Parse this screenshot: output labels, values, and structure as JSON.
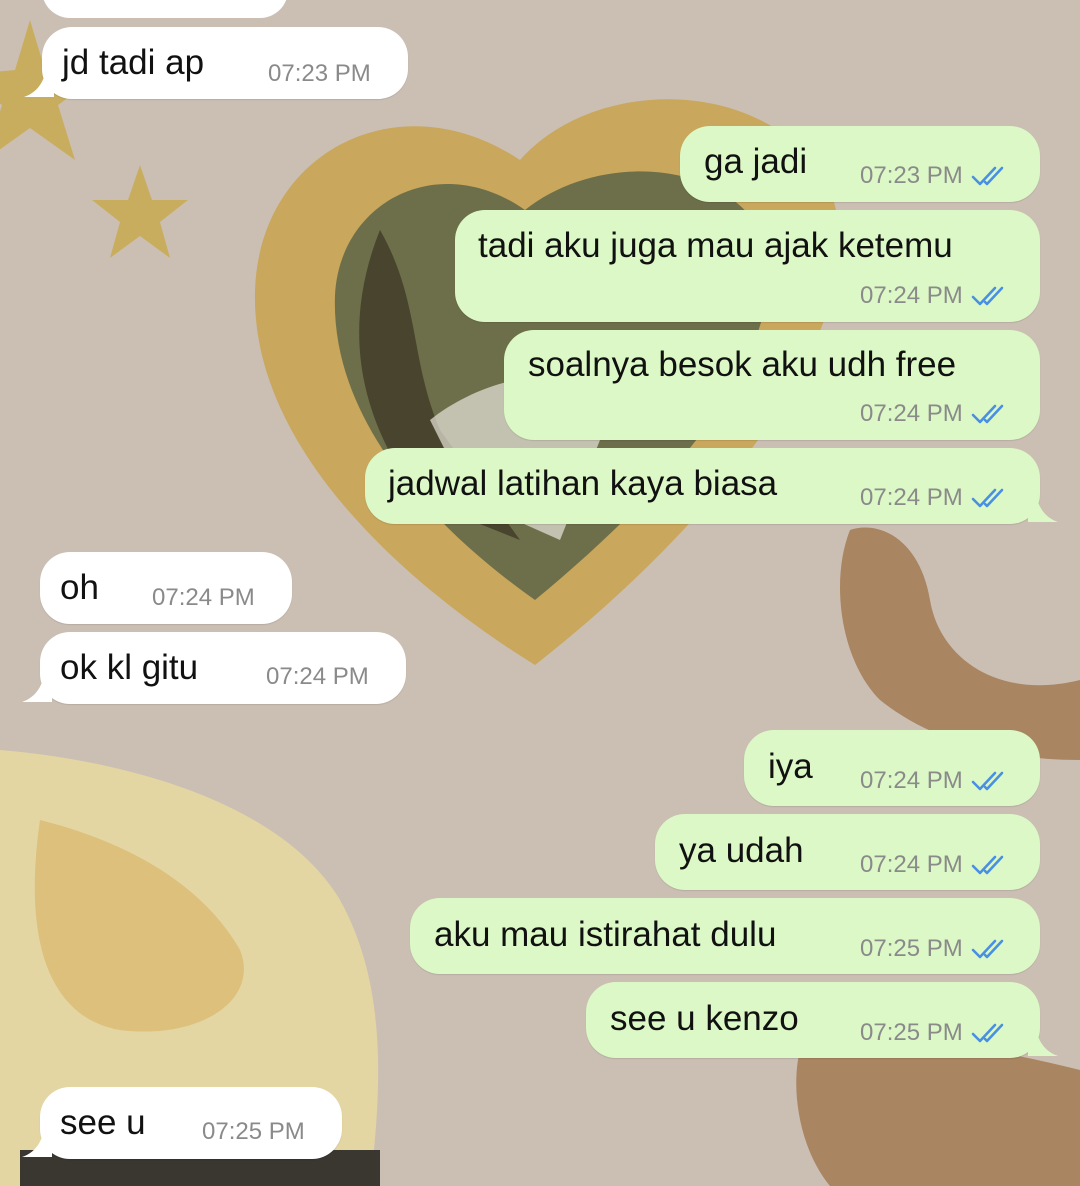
{
  "colors": {
    "incoming_bubble": "#ffffff",
    "outgoing_bubble": "#dcf8c6",
    "read_check": "#4a90e2",
    "timestamp": "#8a8a8a"
  },
  "chat": {
    "messages": [
      {
        "direction": "incoming",
        "text": "jd tadi ap",
        "time": "07:23 PM"
      },
      {
        "direction": "outgoing",
        "text": "ga jadi",
        "time": "07:23 PM",
        "status": "read"
      },
      {
        "direction": "outgoing",
        "text": "tadi aku juga mau ajak ketemu",
        "time": "07:24 PM",
        "status": "read"
      },
      {
        "direction": "outgoing",
        "text": "soalnya besok aku udh free",
        "time": "07:24 PM",
        "status": "read"
      },
      {
        "direction": "outgoing",
        "text": "jadwal latihan kaya biasa",
        "time": "07:24 PM",
        "status": "read"
      },
      {
        "direction": "incoming",
        "text": "oh",
        "time": "07:24 PM"
      },
      {
        "direction": "incoming",
        "text": "ok kl gitu",
        "time": "07:24 PM"
      },
      {
        "direction": "outgoing",
        "text": "iya",
        "time": "07:24 PM",
        "status": "read"
      },
      {
        "direction": "outgoing",
        "text": "ya udah",
        "time": "07:24 PM",
        "status": "read"
      },
      {
        "direction": "outgoing",
        "text": "aku mau istirahat dulu",
        "time": "07:25 PM",
        "status": "read"
      },
      {
        "direction": "outgoing",
        "text": "see u kenzo",
        "time": "07:25 PM",
        "status": "read"
      },
      {
        "direction": "incoming",
        "text": "see u",
        "time": "07:25 PM"
      }
    ]
  }
}
